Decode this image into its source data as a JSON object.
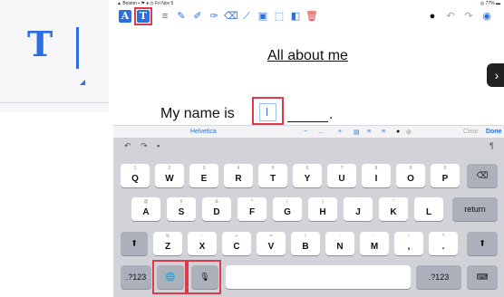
{
  "status_bar": {
    "left": "▲ Boston  ▪ ⚑ ♦ ◷   Fri Nov 5",
    "right": "◎ 77% ▬"
  },
  "toolbar": {
    "text_a_label": "A",
    "text_t_label": "T"
  },
  "zoom": {
    "text_tool_letter": "T"
  },
  "document": {
    "title": "All about me",
    "sentence_prefix": "My name is",
    "sentence_suffix": "."
  },
  "nav_arrow": "›",
  "format_bar": {
    "font_name": "Helvetica",
    "size_minus": "−",
    "size_value": "...",
    "size_plus": "+",
    "clear_label": "Clear",
    "done_label": "Done"
  },
  "keyboard": {
    "row1": [
      {
        "hint": "1",
        "main": "Q"
      },
      {
        "hint": "2",
        "main": "W"
      },
      {
        "hint": "3",
        "main": "E"
      },
      {
        "hint": "4",
        "main": "R"
      },
      {
        "hint": "5",
        "main": "T"
      },
      {
        "hint": "6",
        "main": "Y"
      },
      {
        "hint": "7",
        "main": "U"
      },
      {
        "hint": "8",
        "main": "I"
      },
      {
        "hint": "9",
        "main": "O"
      },
      {
        "hint": "0",
        "main": "P"
      }
    ],
    "row2": [
      {
        "hint": "@",
        "main": "A"
      },
      {
        "hint": "#",
        "main": "S"
      },
      {
        "hint": "&",
        "main": "D"
      },
      {
        "hint": "*",
        "main": "F"
      },
      {
        "hint": "(",
        "main": "G"
      },
      {
        "hint": ")",
        "main": "H"
      },
      {
        "hint": "'",
        "main": "J"
      },
      {
        "hint": "\"",
        "main": "K"
      },
      {
        "hint": "",
        "main": "L"
      }
    ],
    "row3": [
      {
        "hint": "%",
        "main": "Z"
      },
      {
        "hint": "-",
        "main": "X"
      },
      {
        "hint": "+",
        "main": "C"
      },
      {
        "hint": "=",
        "main": "V"
      },
      {
        "hint": "/",
        "main": "B"
      },
      {
        "hint": ";",
        "main": "N"
      },
      {
        "hint": ":",
        "main": "M"
      },
      {
        "hint": "!",
        "main": ","
      },
      {
        "hint": "?",
        "main": "."
      }
    ],
    "return_label": "return",
    "numbers_label": ".?123",
    "numbers_label_right": ".?123",
    "globe_icon": "globe-icon",
    "mic_icon": "microphone-icon"
  }
}
